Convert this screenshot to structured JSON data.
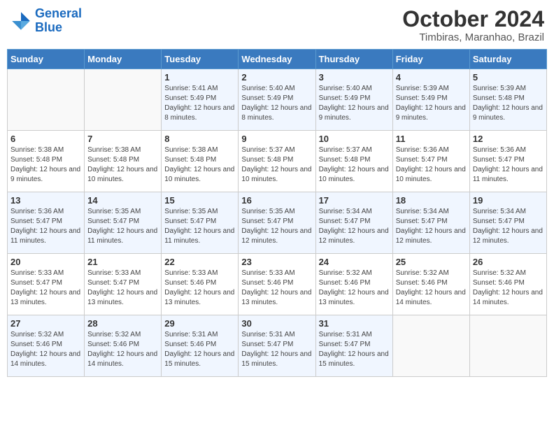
{
  "header": {
    "logo_general": "General",
    "logo_blue": "Blue",
    "month_title": "October 2024",
    "location": "Timbiras, Maranhao, Brazil"
  },
  "days_of_week": [
    "Sunday",
    "Monday",
    "Tuesday",
    "Wednesday",
    "Thursday",
    "Friday",
    "Saturday"
  ],
  "weeks": [
    [
      {
        "day": "",
        "sunrise": "",
        "sunset": "",
        "daylight": ""
      },
      {
        "day": "",
        "sunrise": "",
        "sunset": "",
        "daylight": ""
      },
      {
        "day": "1",
        "sunrise": "Sunrise: 5:41 AM",
        "sunset": "Sunset: 5:49 PM",
        "daylight": "Daylight: 12 hours and 8 minutes."
      },
      {
        "day": "2",
        "sunrise": "Sunrise: 5:40 AM",
        "sunset": "Sunset: 5:49 PM",
        "daylight": "Daylight: 12 hours and 8 minutes."
      },
      {
        "day": "3",
        "sunrise": "Sunrise: 5:40 AM",
        "sunset": "Sunset: 5:49 PM",
        "daylight": "Daylight: 12 hours and 9 minutes."
      },
      {
        "day": "4",
        "sunrise": "Sunrise: 5:39 AM",
        "sunset": "Sunset: 5:49 PM",
        "daylight": "Daylight: 12 hours and 9 minutes."
      },
      {
        "day": "5",
        "sunrise": "Sunrise: 5:39 AM",
        "sunset": "Sunset: 5:48 PM",
        "daylight": "Daylight: 12 hours and 9 minutes."
      }
    ],
    [
      {
        "day": "6",
        "sunrise": "Sunrise: 5:38 AM",
        "sunset": "Sunset: 5:48 PM",
        "daylight": "Daylight: 12 hours and 9 minutes."
      },
      {
        "day": "7",
        "sunrise": "Sunrise: 5:38 AM",
        "sunset": "Sunset: 5:48 PM",
        "daylight": "Daylight: 12 hours and 10 minutes."
      },
      {
        "day": "8",
        "sunrise": "Sunrise: 5:38 AM",
        "sunset": "Sunset: 5:48 PM",
        "daylight": "Daylight: 12 hours and 10 minutes."
      },
      {
        "day": "9",
        "sunrise": "Sunrise: 5:37 AM",
        "sunset": "Sunset: 5:48 PM",
        "daylight": "Daylight: 12 hours and 10 minutes."
      },
      {
        "day": "10",
        "sunrise": "Sunrise: 5:37 AM",
        "sunset": "Sunset: 5:48 PM",
        "daylight": "Daylight: 12 hours and 10 minutes."
      },
      {
        "day": "11",
        "sunrise": "Sunrise: 5:36 AM",
        "sunset": "Sunset: 5:47 PM",
        "daylight": "Daylight: 12 hours and 10 minutes."
      },
      {
        "day": "12",
        "sunrise": "Sunrise: 5:36 AM",
        "sunset": "Sunset: 5:47 PM",
        "daylight": "Daylight: 12 hours and 11 minutes."
      }
    ],
    [
      {
        "day": "13",
        "sunrise": "Sunrise: 5:36 AM",
        "sunset": "Sunset: 5:47 PM",
        "daylight": "Daylight: 12 hours and 11 minutes."
      },
      {
        "day": "14",
        "sunrise": "Sunrise: 5:35 AM",
        "sunset": "Sunset: 5:47 PM",
        "daylight": "Daylight: 12 hours and 11 minutes."
      },
      {
        "day": "15",
        "sunrise": "Sunrise: 5:35 AM",
        "sunset": "Sunset: 5:47 PM",
        "daylight": "Daylight: 12 hours and 11 minutes."
      },
      {
        "day": "16",
        "sunrise": "Sunrise: 5:35 AM",
        "sunset": "Sunset: 5:47 PM",
        "daylight": "Daylight: 12 hours and 12 minutes."
      },
      {
        "day": "17",
        "sunrise": "Sunrise: 5:34 AM",
        "sunset": "Sunset: 5:47 PM",
        "daylight": "Daylight: 12 hours and 12 minutes."
      },
      {
        "day": "18",
        "sunrise": "Sunrise: 5:34 AM",
        "sunset": "Sunset: 5:47 PM",
        "daylight": "Daylight: 12 hours and 12 minutes."
      },
      {
        "day": "19",
        "sunrise": "Sunrise: 5:34 AM",
        "sunset": "Sunset: 5:47 PM",
        "daylight": "Daylight: 12 hours and 12 minutes."
      }
    ],
    [
      {
        "day": "20",
        "sunrise": "Sunrise: 5:33 AM",
        "sunset": "Sunset: 5:47 PM",
        "daylight": "Daylight: 12 hours and 13 minutes."
      },
      {
        "day": "21",
        "sunrise": "Sunrise: 5:33 AM",
        "sunset": "Sunset: 5:47 PM",
        "daylight": "Daylight: 12 hours and 13 minutes."
      },
      {
        "day": "22",
        "sunrise": "Sunrise: 5:33 AM",
        "sunset": "Sunset: 5:46 PM",
        "daylight": "Daylight: 12 hours and 13 minutes."
      },
      {
        "day": "23",
        "sunrise": "Sunrise: 5:33 AM",
        "sunset": "Sunset: 5:46 PM",
        "daylight": "Daylight: 12 hours and 13 minutes."
      },
      {
        "day": "24",
        "sunrise": "Sunrise: 5:32 AM",
        "sunset": "Sunset: 5:46 PM",
        "daylight": "Daylight: 12 hours and 13 minutes."
      },
      {
        "day": "25",
        "sunrise": "Sunrise: 5:32 AM",
        "sunset": "Sunset: 5:46 PM",
        "daylight": "Daylight: 12 hours and 14 minutes."
      },
      {
        "day": "26",
        "sunrise": "Sunrise: 5:32 AM",
        "sunset": "Sunset: 5:46 PM",
        "daylight": "Daylight: 12 hours and 14 minutes."
      }
    ],
    [
      {
        "day": "27",
        "sunrise": "Sunrise: 5:32 AM",
        "sunset": "Sunset: 5:46 PM",
        "daylight": "Daylight: 12 hours and 14 minutes."
      },
      {
        "day": "28",
        "sunrise": "Sunrise: 5:32 AM",
        "sunset": "Sunset: 5:46 PM",
        "daylight": "Daylight: 12 hours and 14 minutes."
      },
      {
        "day": "29",
        "sunrise": "Sunrise: 5:31 AM",
        "sunset": "Sunset: 5:46 PM",
        "daylight": "Daylight: 12 hours and 15 minutes."
      },
      {
        "day": "30",
        "sunrise": "Sunrise: 5:31 AM",
        "sunset": "Sunset: 5:47 PM",
        "daylight": "Daylight: 12 hours and 15 minutes."
      },
      {
        "day": "31",
        "sunrise": "Sunrise: 5:31 AM",
        "sunset": "Sunset: 5:47 PM",
        "daylight": "Daylight: 12 hours and 15 minutes."
      },
      {
        "day": "",
        "sunrise": "",
        "sunset": "",
        "daylight": ""
      },
      {
        "day": "",
        "sunrise": "",
        "sunset": "",
        "daylight": ""
      }
    ]
  ]
}
